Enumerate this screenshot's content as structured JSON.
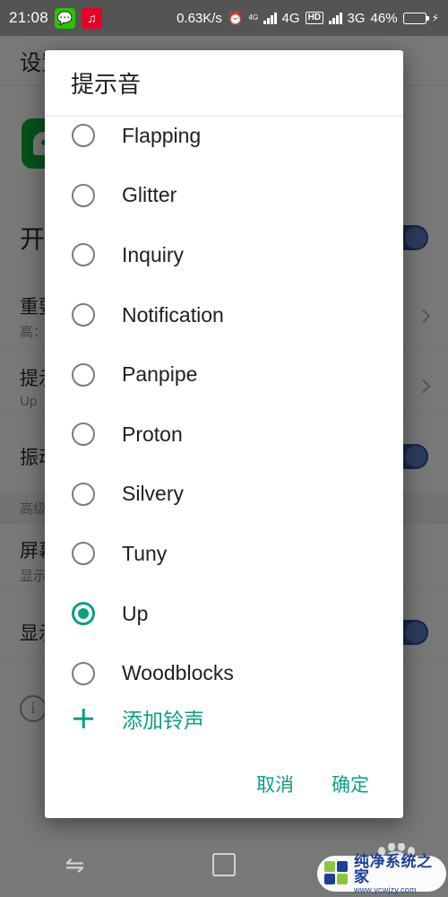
{
  "status_bar": {
    "clock": "21:08",
    "apps": [
      {
        "name": "wechat-icon",
        "glyph": "💬"
      },
      {
        "name": "netease-music-icon",
        "glyph": "♫"
      }
    ],
    "net_speed": "0.63K/s",
    "alarm_icon": "⏰",
    "data_arrows_label": "4G",
    "network_1": "4G",
    "hd_badge": "HD",
    "network_2": "3G",
    "battery_percent": "46%",
    "battery_fill_pct": 46,
    "charging_icon": "⚡"
  },
  "background": {
    "page_title": "设置",
    "app_icon_name": "wechat-app-icon",
    "enable_row": {
      "label": "开",
      "toggle_on": true
    },
    "rows": [
      {
        "title": "重要",
        "subtitle": "高：",
        "accessory": "chevron"
      },
      {
        "title": "提示音",
        "subtitle": "Up",
        "accessory": "chevron"
      },
      {
        "title": "振动",
        "subtitle": "",
        "accessory": "toggle"
      }
    ],
    "section_header": "高级",
    "rows2": [
      {
        "title": "屏幕",
        "subtitle": "显示",
        "accessory": "none"
      },
      {
        "title": "显示",
        "subtitle": "",
        "accessory": "toggle"
      }
    ],
    "info_icon_label": "i"
  },
  "dialog": {
    "title": "提示音",
    "sounds": [
      {
        "label": "Flapping",
        "selected": false
      },
      {
        "label": "Glitter",
        "selected": false
      },
      {
        "label": "Inquiry",
        "selected": false
      },
      {
        "label": "Notification",
        "selected": false
      },
      {
        "label": "Panpipe",
        "selected": false
      },
      {
        "label": "Proton",
        "selected": false
      },
      {
        "label": "Silvery",
        "selected": false
      },
      {
        "label": "Tuny",
        "selected": false
      },
      {
        "label": "Up",
        "selected": true
      },
      {
        "label": "Woodblocks",
        "selected": false
      }
    ],
    "add_ringtone_label": "添加铃声",
    "cancel_label": "取消",
    "confirm_label": "确定",
    "accent_color": "#0d9e84"
  },
  "nav_bar": {
    "recent_icon": "⇋",
    "home_icon": "square",
    "back_icon": "◁"
  },
  "watermark": {
    "brand": "纯净系统之家",
    "url": "www.ycwjzy.com"
  }
}
